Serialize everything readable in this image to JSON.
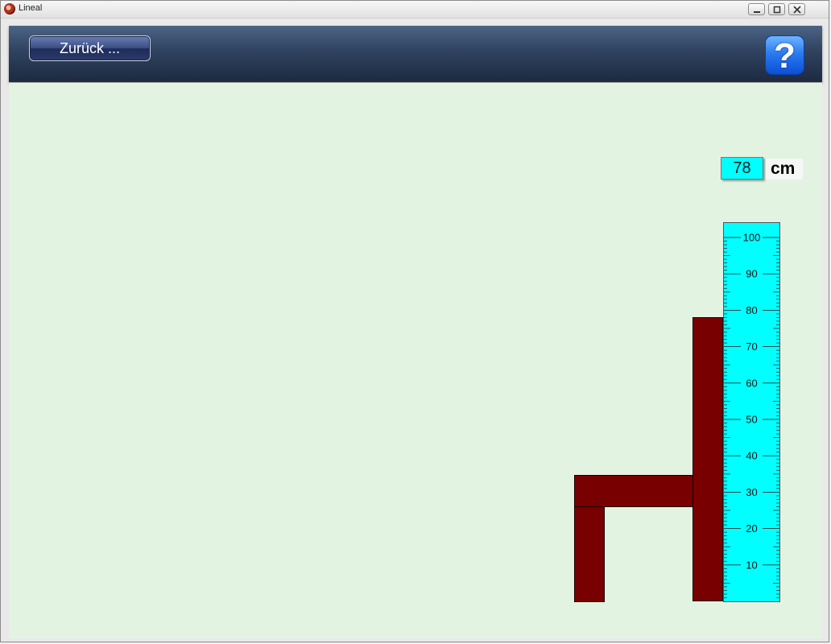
{
  "window": {
    "title": "Lineal"
  },
  "toolbar": {
    "back_label": "Zurück ...",
    "help_label": "?"
  },
  "measurement": {
    "value": "78",
    "unit": "cm",
    "max": 100,
    "measured_height_cm": 78
  },
  "ruler": {
    "labels": [
      "10",
      "20",
      "30",
      "40",
      "50",
      "60",
      "70",
      "80",
      "90",
      "100"
    ],
    "color": "#00ffff"
  },
  "chair": {
    "color": "#780000"
  },
  "colors": {
    "canvas": "#e2f3e2",
    "toolbar": "#2f425f"
  }
}
